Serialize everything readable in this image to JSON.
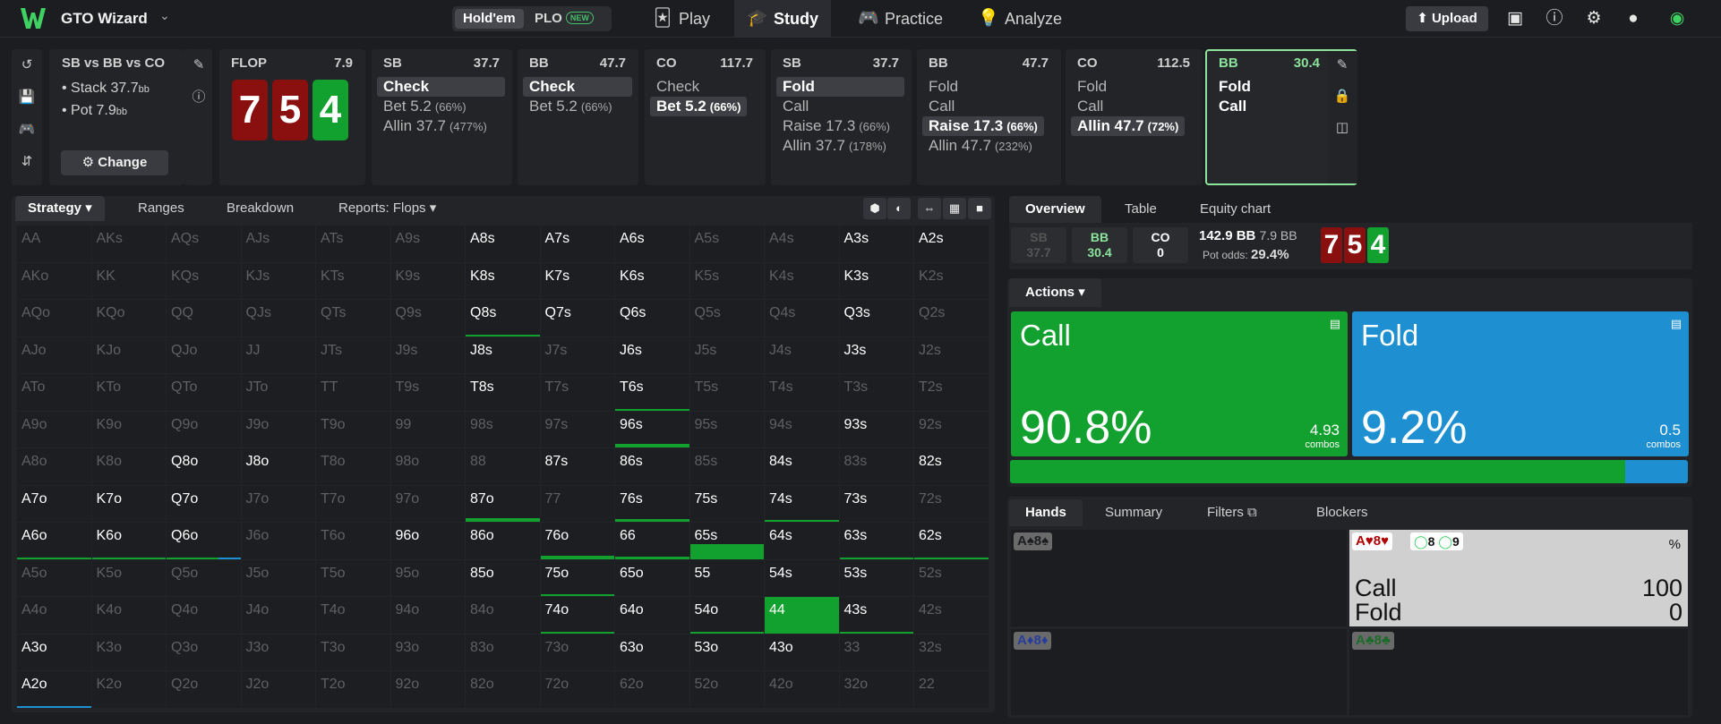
{
  "app": {
    "brand": "GTO Wizard"
  },
  "game_toggle": {
    "holdem": "Hold'em",
    "plo": "PLO",
    "new_badge": "NEW"
  },
  "nav": {
    "play": "Play",
    "study": "Study",
    "practice": "Practice",
    "analyze": "Analyze"
  },
  "topright": {
    "upload": "Upload"
  },
  "spot": {
    "title": "SB vs BB vs CO",
    "stack": "Stack 37.7",
    "stack_unit": "bb",
    "pot": "Pot 7.9",
    "pot_unit": "bb",
    "change": "Change"
  },
  "flop": {
    "label": "FLOP",
    "pot": "7.9",
    "cards": [
      "7",
      "5",
      "4"
    ]
  },
  "nodes": [
    {
      "player": "SB",
      "value": "37.7",
      "actions": [
        {
          "label": "Check",
          "pct": ""
        },
        {
          "label": "Bet 5.2",
          "pct": "(66%)"
        },
        {
          "label": "Allin 37.7",
          "pct": "(477%)"
        }
      ]
    },
    {
      "player": "BB",
      "value": "47.7",
      "actions": [
        {
          "label": "Check",
          "pct": ""
        },
        {
          "label": "Bet 5.2",
          "pct": "(66%)"
        }
      ]
    },
    {
      "player": "CO",
      "value": "117.7",
      "actions": [
        {
          "label": "Check",
          "pct": ""
        },
        {
          "label": "Bet 5.2",
          "pct": "(66%)"
        }
      ]
    },
    {
      "player": "SB",
      "value": "37.7",
      "actions": [
        {
          "label": "Fold",
          "pct": ""
        },
        {
          "label": "Call",
          "pct": ""
        },
        {
          "label": "Raise 17.3",
          "pct": "(66%)"
        },
        {
          "label": "Allin 37.7",
          "pct": "(178%)"
        }
      ]
    },
    {
      "player": "BB",
      "value": "47.7",
      "actions": [
        {
          "label": "Fold",
          "pct": ""
        },
        {
          "label": "Call",
          "pct": ""
        },
        {
          "label": "Raise 17.3",
          "pct": "(66%)"
        },
        {
          "label": "Allin 47.7",
          "pct": "(232%)"
        }
      ]
    },
    {
      "player": "CO",
      "value": "112.5",
      "actions": [
        {
          "label": "Fold",
          "pct": ""
        },
        {
          "label": "Call",
          "pct": ""
        },
        {
          "label": "Allin 47.7",
          "pct": "(72%)"
        }
      ]
    },
    {
      "player": "BB",
      "value": "30.4",
      "actions": [
        {
          "label": "Fold",
          "pct": ""
        },
        {
          "label": "Call",
          "pct": ""
        }
      ]
    }
  ],
  "left_tabs": {
    "strategy": "Strategy",
    "ranges": "Ranges",
    "breakdown": "Breakdown",
    "reports": "Reports: Flops"
  },
  "matrix": [
    [
      "AA",
      "AKs",
      "AQs",
      "AJs",
      "ATs",
      "A9s",
      "A8s",
      "A7s",
      "A6s",
      "A5s",
      "A4s",
      "A3s",
      "A2s"
    ],
    [
      "AKo",
      "KK",
      "KQs",
      "KJs",
      "KTs",
      "K9s",
      "K8s",
      "K7s",
      "K6s",
      "K5s",
      "K4s",
      "K3s",
      "K2s"
    ],
    [
      "AQo",
      "KQo",
      "QQ",
      "QJs",
      "QTs",
      "Q9s",
      "Q8s",
      "Q7s",
      "Q6s",
      "Q5s",
      "Q4s",
      "Q3s",
      "Q2s"
    ],
    [
      "AJo",
      "KJo",
      "QJo",
      "JJ",
      "JTs",
      "J9s",
      "J8s",
      "J7s",
      "J6s",
      "J5s",
      "J4s",
      "J3s",
      "J2s"
    ],
    [
      "ATo",
      "KTo",
      "QTo",
      "JTo",
      "TT",
      "T9s",
      "T8s",
      "T7s",
      "T6s",
      "T5s",
      "T4s",
      "T3s",
      "T2s"
    ],
    [
      "A9o",
      "K9o",
      "Q9o",
      "J9o",
      "T9o",
      "99",
      "98s",
      "97s",
      "96s",
      "95s",
      "94s",
      "93s",
      "92s"
    ],
    [
      "A8o",
      "K8o",
      "Q8o",
      "J8o",
      "T8o",
      "98o",
      "88",
      "87s",
      "86s",
      "85s",
      "84s",
      "83s",
      "82s"
    ],
    [
      "A7o",
      "K7o",
      "Q7o",
      "J7o",
      "T7o",
      "97o",
      "87o",
      "77",
      "76s",
      "75s",
      "74s",
      "73s",
      "72s"
    ],
    [
      "A6o",
      "K6o",
      "Q6o",
      "J6o",
      "T6o",
      "96o",
      "86o",
      "76o",
      "66",
      "65s",
      "64s",
      "63s",
      "62s"
    ],
    [
      "A5o",
      "K5o",
      "Q5o",
      "J5o",
      "T5o",
      "95o",
      "85o",
      "75o",
      "65o",
      "55",
      "54s",
      "53s",
      "52s"
    ],
    [
      "A4o",
      "K4o",
      "Q4o",
      "J4o",
      "T4o",
      "94o",
      "84o",
      "74o",
      "64o",
      "54o",
      "44",
      "43s",
      "42s"
    ],
    [
      "A3o",
      "K3o",
      "Q3o",
      "J3o",
      "T3o",
      "93o",
      "83o",
      "73o",
      "63o",
      "53o",
      "43o",
      "33",
      "32s"
    ],
    [
      "A2o",
      "K2o",
      "Q2o",
      "J2o",
      "T2o",
      "92o",
      "82o",
      "72o",
      "62o",
      "52o",
      "42o",
      "32o",
      "22"
    ]
  ],
  "active_hands": [
    "A8s",
    "A7s",
    "A6s",
    "A3s",
    "A2s",
    "K8s",
    "K7s",
    "K6s",
    "K3s",
    "Q8s",
    "Q7s",
    "Q6s",
    "Q3s",
    "J8s",
    "J6s",
    "J3s",
    "T8s",
    "T6s",
    "96s",
    "93s",
    "Q8o",
    "J8o",
    "87s",
    "86s",
    "84s",
    "82s",
    "A7o",
    "K7o",
    "Q7o",
    "87o",
    "76s",
    "75s",
    "74s",
    "73s",
    "A6o",
    "K6o",
    "Q6o",
    "96o",
    "86o",
    "76o",
    "66",
    "65s",
    "64s",
    "63s",
    "62s",
    "85o",
    "75o",
    "65o",
    "55",
    "54s",
    "53s",
    "74o",
    "64o",
    "54o",
    "44",
    "43s",
    "A3o",
    "63o",
    "53o",
    "43o",
    "A2o"
  ],
  "hand_freq": {
    "Q8s": {
      "call": 0.01,
      "fold": 0
    },
    "T6s": {
      "call": 0.01,
      "fold": 0
    },
    "96s": {
      "call": 0.1,
      "fold": 0
    },
    "87o": {
      "call": 0.1,
      "fold": 0
    },
    "76s": {
      "call": 0.08,
      "fold": 0
    },
    "74s": {
      "call": 0.03,
      "fold": 0
    },
    "A6o": {
      "call": 0.03,
      "fold": 0
    },
    "K6o": {
      "call": 0.04,
      "fold": 0
    },
    "Q6o": {
      "call": 0.02,
      "fold": 0.04
    },
    "76o": {
      "call": 0.08,
      "fold": 0
    },
    "66": {
      "call": 0.05,
      "fold": 0
    },
    "65s": {
      "call": 0.4,
      "fold": 0
    },
    "63s": {
      "call": 0.04,
      "fold": 0
    },
    "62s": {
      "call": 0.04,
      "fold": 0
    },
    "75o": {
      "call": 0.06,
      "fold": 0
    },
    "54o": {
      "call": 0.04,
      "fold": 0
    },
    "74o": {
      "call": 0.04,
      "fold": 0
    },
    "44": {
      "call": 1,
      "fold": 0
    },
    "43s": {
      "call": 0.03,
      "fold": 0
    },
    "A2o": {
      "call": 0,
      "fold": 0.04
    }
  },
  "right_tabs": {
    "overview": "Overview",
    "table": "Table",
    "equity": "Equity chart"
  },
  "players": [
    {
      "pos": "SB",
      "stack": "37.7"
    },
    {
      "pos": "BB",
      "stack": "30.4"
    },
    {
      "pos": "CO",
      "stack": "0"
    }
  ],
  "pot_info": {
    "total": "142.9 BB",
    "pot": "7.9 BB",
    "odds_label": "Pot odds:",
    "odds": "29.4%"
  },
  "actions_label": "Actions",
  "actions": [
    {
      "name": "Call",
      "pct": "90.8%",
      "combos": "4.93",
      "combos_label": "combos",
      "color": "#12a02e",
      "freq": 0.908
    },
    {
      "name": "Fold",
      "pct": "9.2%",
      "combos": "0.5",
      "combos_label": "combos",
      "color": "#1e8fd1",
      "freq": 0.092
    }
  ],
  "hands_tabs": {
    "hands": "Hands",
    "summary": "Summary",
    "filters": "Filters",
    "blockers": "Blockers"
  },
  "hands_list": [
    {
      "combo": "A♠8♠"
    },
    {
      "combo": "A♥8♥",
      "selected": true,
      "pct_label": "%",
      "blocker1": "8",
      "blocker2": "9",
      "rows": [
        {
          "label": "Call",
          "value": "100"
        },
        {
          "label": "Fold",
          "value": "0"
        }
      ]
    },
    {
      "combo": "A♦8♦"
    },
    {
      "combo": "A♣8♣"
    }
  ]
}
